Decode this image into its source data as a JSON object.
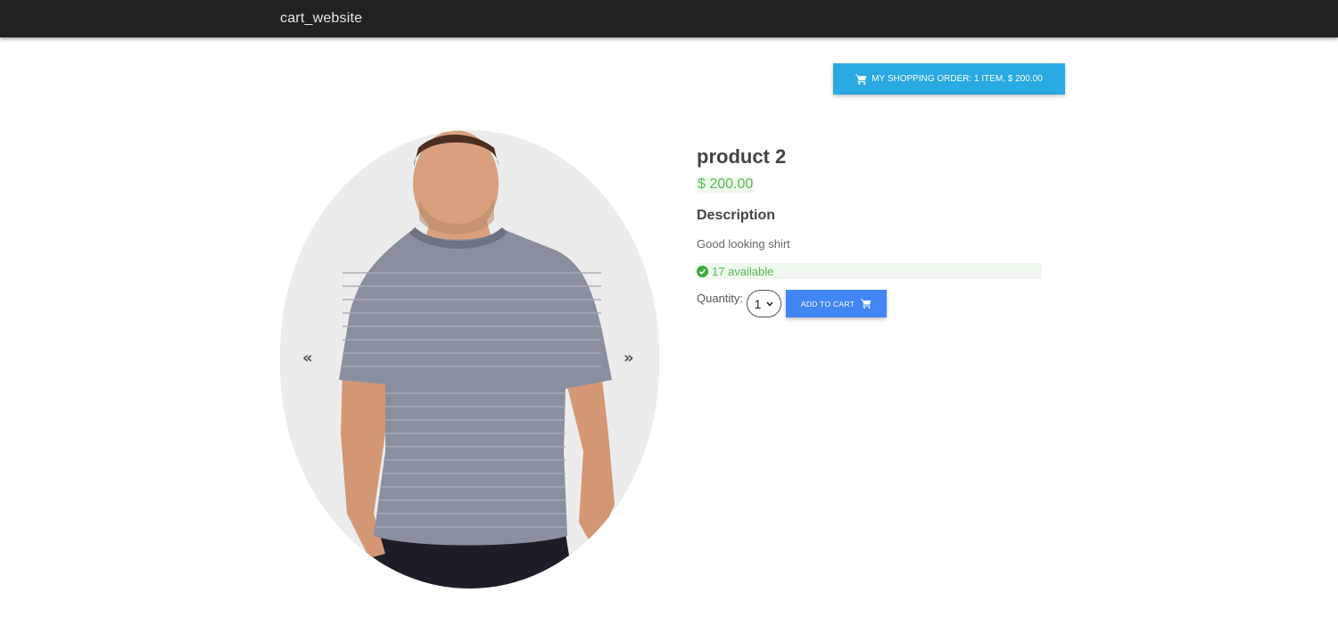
{
  "navbar": {
    "brand": "cart_website"
  },
  "order_button": {
    "label": "My Shopping Order: 1 item, $ 200.00",
    "icon": "cart-icon"
  },
  "product": {
    "title": "product 2",
    "price": "$ 200.00",
    "description_heading": "Description",
    "description": "Good looking shirt",
    "stock": "17 available",
    "quantity_label": "Quantity:",
    "quantity_value": "1",
    "add_to_cart_label": "Add to cart"
  },
  "gallery": {
    "prev_label": "«",
    "next_label": "»"
  },
  "colors": {
    "navbar": "#212121",
    "order_button": "#29aae3",
    "add_to_cart": "#4285f4",
    "price": "#5cb85c"
  }
}
